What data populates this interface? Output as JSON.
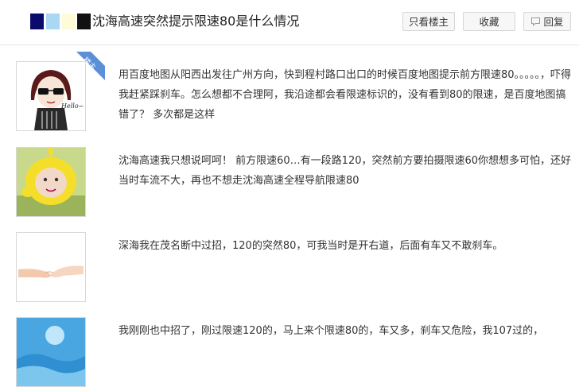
{
  "header": {
    "title": "沈海高速突然提示限速80是什么情况",
    "buttons": {
      "only_op": "只看楼主",
      "favorite": "收藏",
      "reply": "回复"
    }
  },
  "posts": [
    {
      "avatar": "sunglasses-girl-avatar",
      "avatar_text": "Hello~",
      "badge": "楼主",
      "text": "用百度地图从阳西出发往广州方向，快到程村路口出口的时候百度地图提示前方限速80。。。。。，吓得我赶紧踩刹车。怎么想都不合理阿，我沿途都会看限速标识的，没有看到80的限速，是百度地图搞错了？ 多次都是这样"
    },
    {
      "avatar": "teletubby-avatar",
      "text": "沈海高速我只想说呵呵！ 前方限速60…有一段路120，突然前方要拍摄限速60你想想多可怕，还好当时车流不大，再也不想走沈海高速全程导航限速80"
    },
    {
      "avatar": "holding-hands-avatar",
      "text": "深海我在茂名断中过招，120的突然80，可我当时是开右道，后面有车又不敢刹车。"
    },
    {
      "avatar": "blue-sky-avatar",
      "text": "我刚刚也中招了，刚过限速120的，马上来个限速80的，车又多，刹车又危险，我107过的，"
    }
  ],
  "colors": {
    "badge_bg": "#5b8fd8",
    "header_squares": [
      "#0b0b6b",
      "#a9d8f5",
      "#fffbd8",
      "#111111"
    ]
  }
}
